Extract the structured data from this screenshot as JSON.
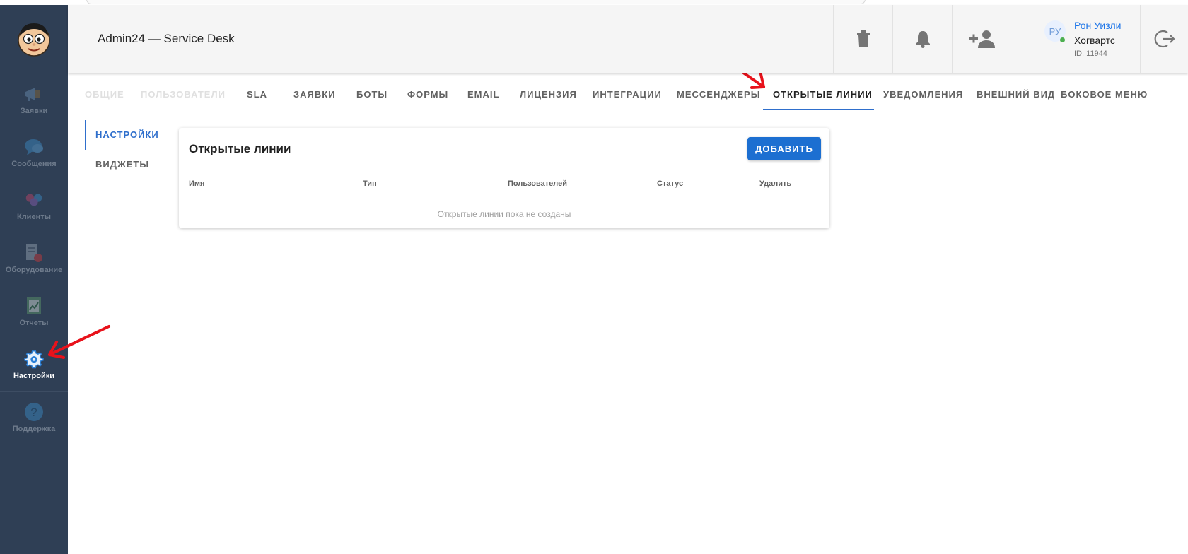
{
  "header": {
    "title": "Admin24 — Service Desk",
    "user": {
      "avatar_text": "РУ",
      "name": "Рон Уизли",
      "org": "Хогвартс",
      "id_text": "ID: 11944"
    }
  },
  "sidebar": {
    "items": [
      {
        "label": "Заявки",
        "icon": "megaphone-icon"
      },
      {
        "label": "Сообщения",
        "icon": "chat-icon"
      },
      {
        "label": "Клиенты",
        "icon": "clients-icon"
      },
      {
        "label": "Оборудование",
        "icon": "equipment-icon"
      },
      {
        "label": "Отчеты",
        "icon": "reports-icon"
      },
      {
        "label": "Настройки",
        "icon": "gear-icon",
        "active": true
      },
      {
        "label": "Поддержка",
        "icon": "help-icon"
      }
    ]
  },
  "tabs": [
    {
      "label": "ОБЩИЕ"
    },
    {
      "label": "ПОЛЬЗОВАТЕЛИ"
    },
    {
      "label": "SLA"
    },
    {
      "label": "ЗАЯВКИ"
    },
    {
      "label": "БОТЫ"
    },
    {
      "label": "ФОРМЫ"
    },
    {
      "label": "EMAIL"
    },
    {
      "label": "ЛИЦЕНЗИЯ"
    },
    {
      "label": "ИНТЕГРАЦИИ"
    },
    {
      "label": "МЕССЕНДЖЕРЫ"
    },
    {
      "label": "ОТКРЫТЫЕ ЛИНИИ",
      "active": true
    },
    {
      "label": "УВЕДОМЛЕНИЯ"
    },
    {
      "label": "ВНЕШНИЙ ВИД"
    },
    {
      "label": "БОКОВОЕ МЕНЮ"
    }
  ],
  "subtabs": [
    {
      "label": "НАСТРОЙКИ",
      "active": true
    },
    {
      "label": "ВИДЖЕТЫ"
    }
  ],
  "card": {
    "title": "Открытые линии",
    "add_button": "ДОБАВИТЬ",
    "columns": [
      "Имя",
      "Тип",
      "Пользователей",
      "Статус",
      "Удалить"
    ],
    "empty_text": "Открытые линии пока не созданы"
  },
  "colors": {
    "sidebar_bg": "#2f3f55",
    "accent": "#2f6fcc",
    "button": "#1c6fd1",
    "annotation_arrow": "#e8121b"
  }
}
